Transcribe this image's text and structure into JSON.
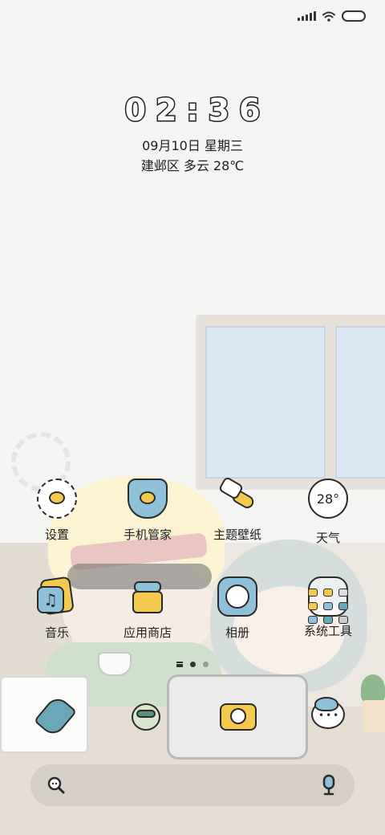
{
  "status_bar": {
    "signal_icon": "signal-bars-icon",
    "wifi_icon": "wifi-icon",
    "battery_icon": "battery-icon"
  },
  "clock": {
    "time": "02:36",
    "date": "09月10日 星期三",
    "weather": "建邺区 多云 28℃"
  },
  "apps": [
    {
      "label": "设置",
      "icon": "settings-icon"
    },
    {
      "label": "手机管家",
      "icon": "security-shield-icon"
    },
    {
      "label": "主题壁纸",
      "icon": "paintbrush-icon"
    },
    {
      "label": "天气",
      "icon": "weather-icon",
      "icon_text": "28°"
    },
    {
      "label": "音乐",
      "icon": "music-icon"
    },
    {
      "label": "应用商店",
      "icon": "app-store-icon"
    },
    {
      "label": "相册",
      "icon": "photos-icon"
    },
    {
      "label": "系统工具",
      "icon": "folder-icon"
    }
  ],
  "pager": {
    "pages": 2,
    "active_page": 1
  },
  "dock": [
    {
      "icon": "phone-icon"
    },
    {
      "icon": "robot-icon"
    },
    {
      "icon": "camera-icon"
    },
    {
      "icon": "messages-icon"
    }
  ],
  "search_bar": {
    "search_icon": "search-icon",
    "mic_icon": "microphone-icon"
  },
  "colors": {
    "yellow": "#f4c94f",
    "blue": "#8ec0da",
    "teal": "#6aa7b8",
    "outline": "#2a2a2a"
  }
}
